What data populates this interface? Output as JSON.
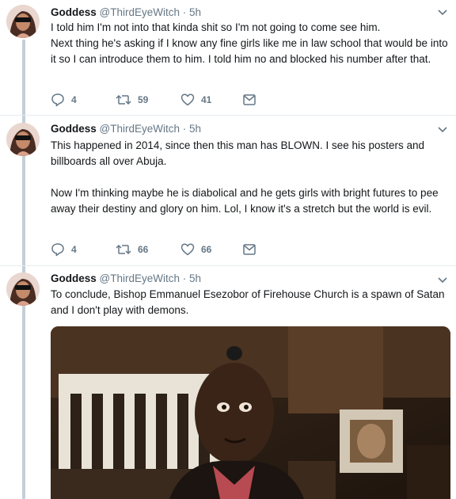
{
  "tweets": [
    {
      "name": "Goddess",
      "handle": "@ThirdEyeWitch",
      "separator": "·",
      "time": "5h",
      "text": "I told him I'm not into that kinda shit so I'm not going to come see him.\nNext thing he's asking if I know any fine girls like me in law school that would be into it so I can introduce them to him. I told him no and blocked his number after that.",
      "replies": "4",
      "retweets": "59",
      "likes": "41"
    },
    {
      "name": "Goddess",
      "handle": "@ThirdEyeWitch",
      "separator": "·",
      "time": "5h",
      "text": "This happened in 2014, since then this man has BLOWN. I see his posters and billboards all over Abuja.\n\nNow I'm thinking maybe he is diabolical and he gets girls with bright futures to pee away their destiny and glory on him. Lol, I know it's a stretch but the world is evil.",
      "replies": "4",
      "retweets": "66",
      "likes": "66"
    },
    {
      "name": "Goddess",
      "handle": "@ThirdEyeWitch",
      "separator": "·",
      "time": "5h",
      "text": "To conclude, Bishop Emmanuel Esezobor of Firehouse Church is a spawn of Satan and I don't play with demons."
    }
  ],
  "icons": {
    "reply": "reply-icon",
    "retweet": "retweet-icon",
    "like": "heart-icon",
    "dm": "envelope-icon",
    "menu": "chevron-down-icon"
  },
  "colors": {
    "thread_line": "#c4cfd6",
    "meta_text": "#657786",
    "primary_text": "#14171a"
  }
}
